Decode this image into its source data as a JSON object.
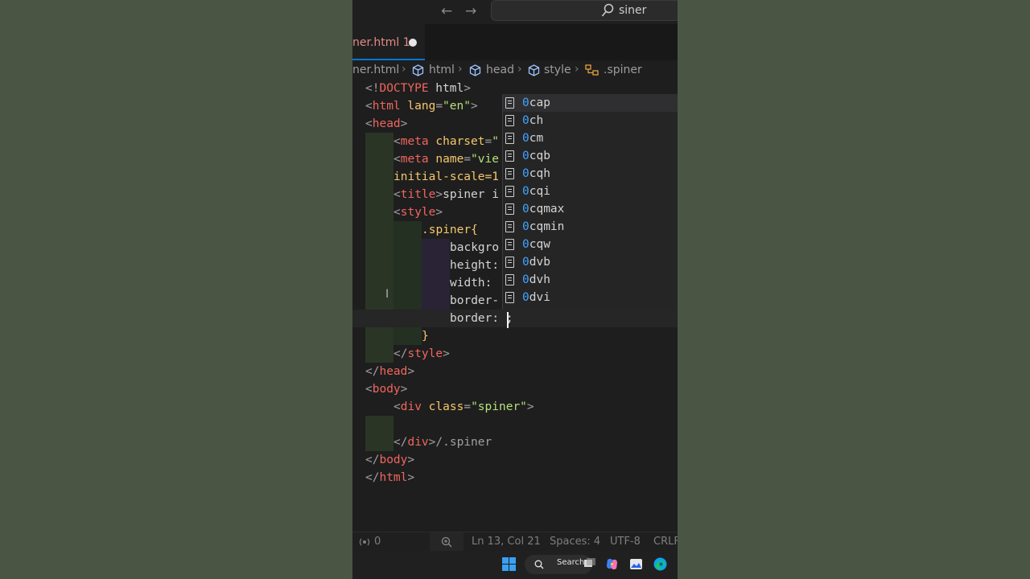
{
  "titlebar": {
    "back_arrow": "←",
    "forward_arrow": "→",
    "search_text": "siner"
  },
  "tab": {
    "name": "ner.html",
    "problems": "1"
  },
  "breadcrumb": {
    "file": "ner.html",
    "html": "html",
    "head": "head",
    "style": "style",
    "selector": ".spiner",
    "separator": "›"
  },
  "code": {
    "l1_a": "<!",
    "l1_b": "DOCTYPE",
    "l1_c": " html",
    "l1_d": ">",
    "l2_tag": "html",
    "l2_attr": "lang",
    "l2_val": "\"en\"",
    "l3_tag": "head",
    "l4_tag": "meta",
    "l4_attr": "charset",
    "l4_val": "\"",
    "l5_tag": "meta",
    "l5_attr": "name",
    "l5_val": "\"vie",
    "l6_text": "initial-scale=1",
    "l7_tag": "title",
    "l7_text": "spiner i",
    "l8_tag": "style",
    "l9_sel": ".spiner",
    "l9_brace": "{",
    "l10_prop": "backgro",
    "l11_prop": "height:",
    "l12_prop": "width:",
    "l13_prop": "border-",
    "l14_prop": "border: ",
    "l14_semi": ";",
    "l15_brace": "}",
    "l16_tag": "style",
    "l17_tag": "head",
    "l18_tag": "body",
    "l19_tag": "div",
    "l19_attr": "class",
    "l19_val": "\"spiner\"",
    "l21_tag": "div",
    "l21_comment": "/.spiner",
    "l22_tag": "body",
    "l23_tag": "html"
  },
  "suggestions": [
    {
      "match": "0",
      "rest": "cap"
    },
    {
      "match": "0",
      "rest": "ch"
    },
    {
      "match": "0",
      "rest": "cm"
    },
    {
      "match": "0",
      "rest": "cqb"
    },
    {
      "match": "0",
      "rest": "cqh"
    },
    {
      "match": "0",
      "rest": "cqi"
    },
    {
      "match": "0",
      "rest": "cqmax"
    },
    {
      "match": "0",
      "rest": "cqmin"
    },
    {
      "match": "0",
      "rest": "cqw"
    },
    {
      "match": "0",
      "rest": "dvb"
    },
    {
      "match": "0",
      "rest": "dvh"
    },
    {
      "match": "0",
      "rest": "dvi"
    }
  ],
  "statusbar": {
    "ports": "0",
    "position": "Ln 13, Col 21",
    "spaces": "Spaces: 4",
    "encoding": "UTF-8",
    "eol": "CRLF"
  },
  "taskbar": {
    "search_label": "Search"
  }
}
